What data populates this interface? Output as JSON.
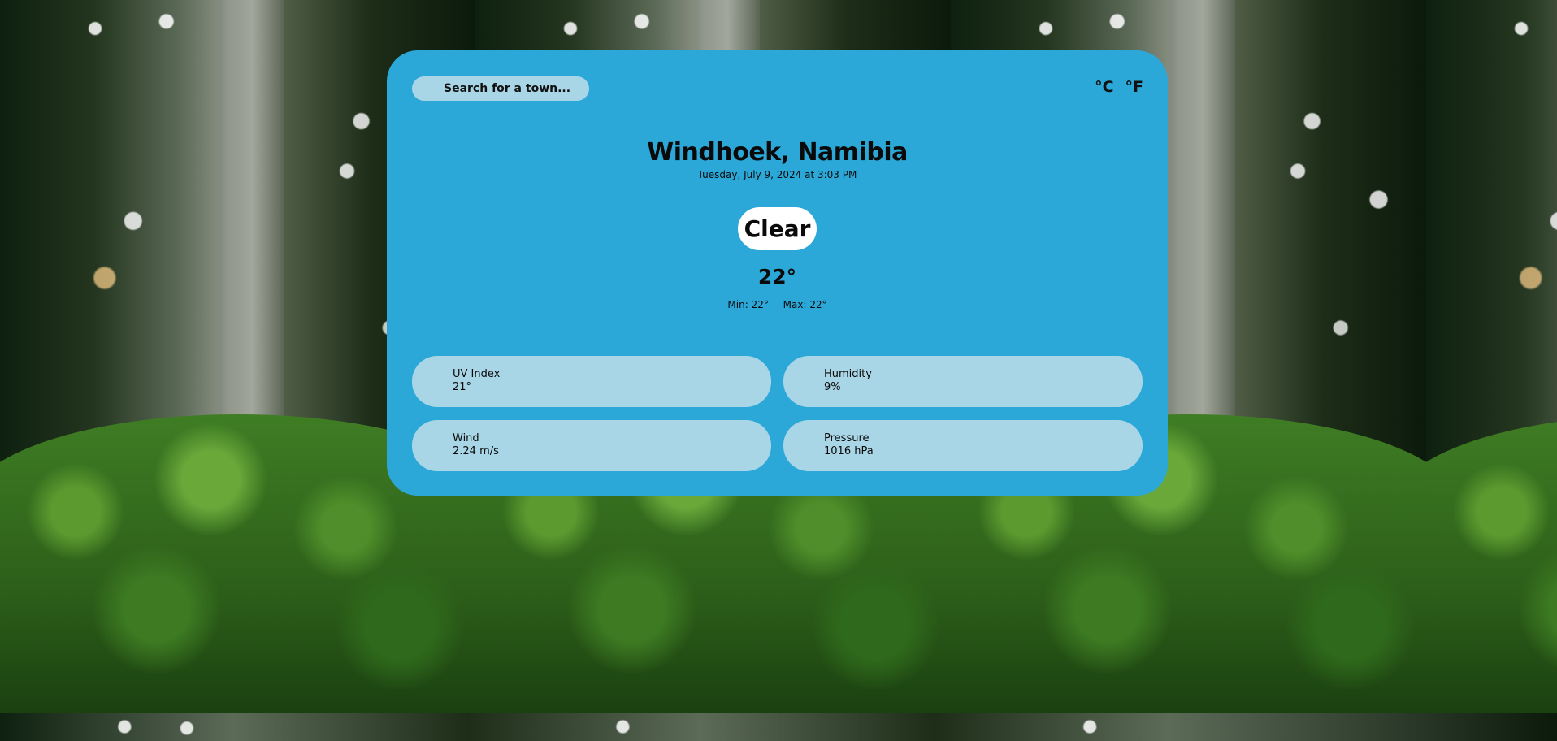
{
  "search": {
    "placeholder": "Search for a town..."
  },
  "units": {
    "celsius": "°C",
    "fahrenheit": "°F"
  },
  "location": {
    "city": "Windhoek, Namibia",
    "datetime": "Tuesday, July 9, 2024 at 3:03 PM"
  },
  "weather": {
    "condition": "Clear",
    "temperature": "22°",
    "min": "Min: 22°",
    "max": "Max: 22°"
  },
  "details": [
    {
      "label": "UV Index",
      "value": "21°"
    },
    {
      "label": "Humidity",
      "value": "9%"
    },
    {
      "label": "Wind",
      "value": "2.24 m/s"
    },
    {
      "label": "Pressure",
      "value": "1016 hPa"
    }
  ],
  "colors": {
    "card": "#2ba8d8",
    "tile": "#a8d6e6",
    "condition_badge": "#ffffff"
  }
}
